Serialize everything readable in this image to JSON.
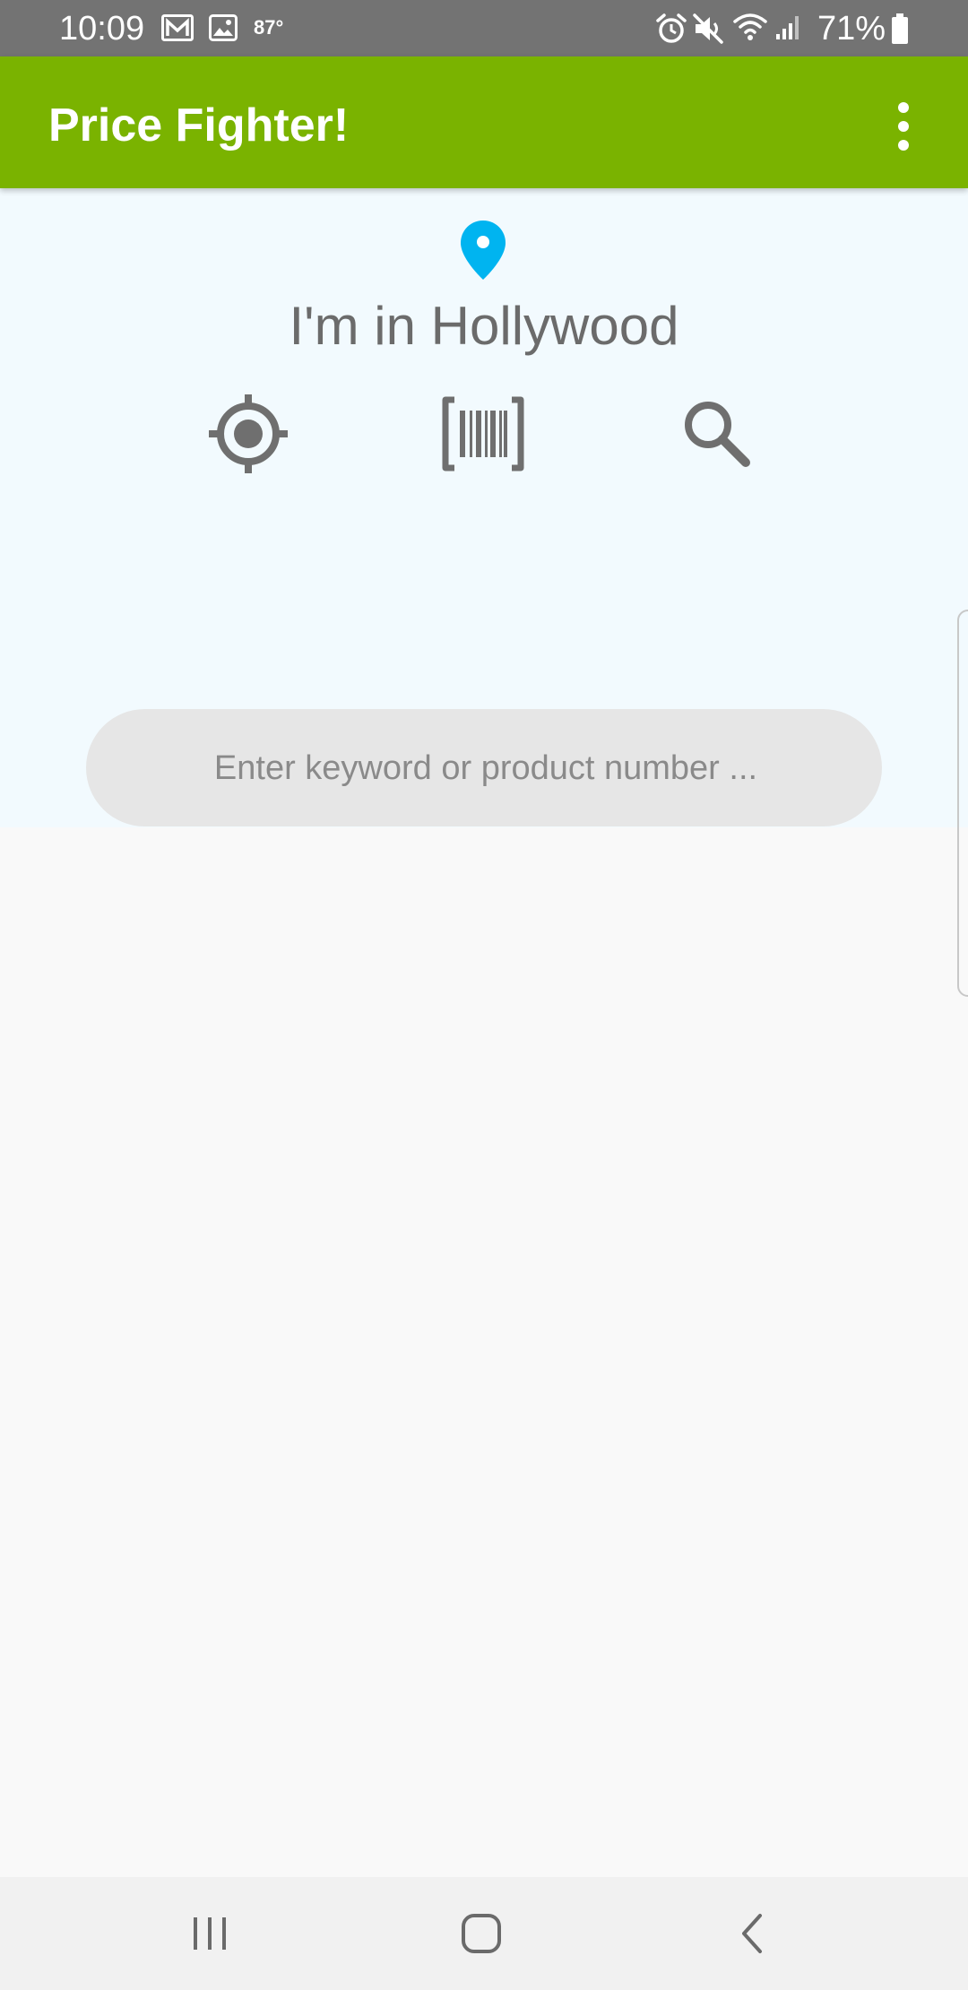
{
  "status_bar": {
    "time": "10:09",
    "temperature": "87°",
    "battery": "71%",
    "icons": [
      "gmail-icon",
      "image-icon",
      "alarm-icon",
      "mute-icon",
      "wifi-icon",
      "signal-icon",
      "battery-icon"
    ]
  },
  "app_bar": {
    "title": "Price Fighter!",
    "menu_icon": "more-vert-icon",
    "color": "#7ab300"
  },
  "location": {
    "icon": "location-pin-icon",
    "icon_color": "#00b4f0",
    "text": "I'm in Hollywood"
  },
  "actions": [
    {
      "name": "locate",
      "icon": "my-location-icon"
    },
    {
      "name": "scan",
      "icon": "barcode-scan-icon"
    },
    {
      "name": "search",
      "icon": "search-icon"
    }
  ],
  "search": {
    "placeholder": "Enter keyword or product number ...",
    "value": ""
  },
  "nav_bar": {
    "buttons": [
      "recents-icon",
      "home-icon",
      "back-icon"
    ]
  }
}
